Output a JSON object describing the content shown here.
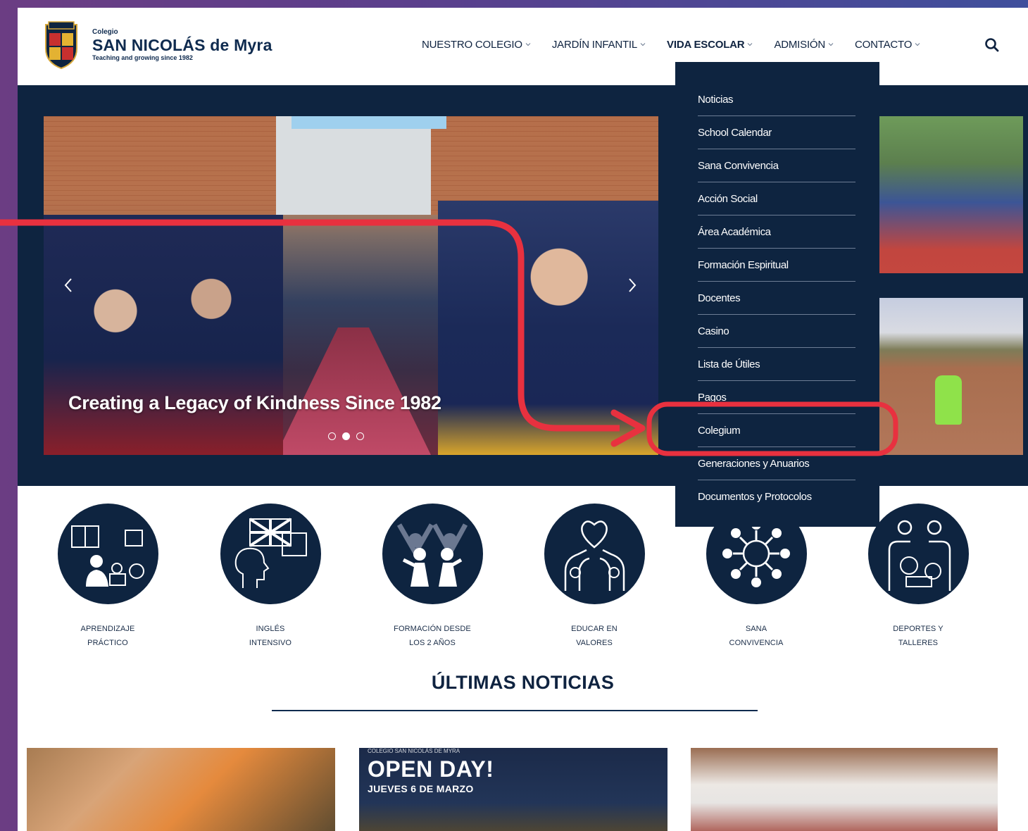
{
  "logo": {
    "small": "Colegio",
    "name": "SAN NICOLÁS de Myra",
    "tagline": "Teaching and growing since 1982"
  },
  "nav": [
    {
      "label": "NUESTRO COLEGIO"
    },
    {
      "label": "JARDÍN INFANTIL"
    },
    {
      "label": "VIDA ESCOLAR",
      "active": true
    },
    {
      "label": "ADMISIÓN"
    },
    {
      "label": "CONTACTO"
    }
  ],
  "search_icon": "search-icon",
  "dropdown": [
    {
      "label": "Noticias"
    },
    {
      "label": "School Calendar"
    },
    {
      "label": "Sana Convivencia"
    },
    {
      "label": "Acción Social"
    },
    {
      "label": "Área Académica"
    },
    {
      "label": "Formación Espiritual"
    },
    {
      "label": "Docentes"
    },
    {
      "label": "Casino"
    },
    {
      "label": "Lista de Útiles"
    },
    {
      "label": "Pagos"
    },
    {
      "label": "Colegium",
      "highlighted": true
    },
    {
      "label": "Generaciones y Anuarios"
    },
    {
      "label": "Documentos y Protocolos"
    }
  ],
  "hero": {
    "caption": "Creating a Legacy of Kindness Since 1982",
    "active_dot": 2,
    "dot_count": 3
  },
  "features": [
    {
      "line1": "APRENDIZAJE",
      "line2": "PRÁCTICO",
      "icon": "learning-icon"
    },
    {
      "line1": "INGLÉS",
      "line2": "INTENSIVO",
      "icon": "english-icon"
    },
    {
      "line1": "FORMACIÓN DESDE",
      "line2": "LOS 2 AÑOS",
      "icon": "children-icon"
    },
    {
      "line1": "EDUCAR EN",
      "line2": "VALORES",
      "icon": "heart-hands-icon"
    },
    {
      "line1": "SANA",
      "line2": "CONVIVENCIA",
      "icon": "community-icon"
    },
    {
      "line1": "DEPORTES Y",
      "line2": "TALLERES",
      "icon": "sports-icon"
    }
  ],
  "news": {
    "title": "ÚLTIMAS NOTICIAS",
    "openday": {
      "school": "COLEGIO SAN NICOLÁS DE MYRA",
      "title": "OPEN DAY!",
      "date": "JUEVES 6 DE MARZO"
    }
  },
  "colors": {
    "navy": "#0e2440",
    "annotation_red": "#e8313f",
    "dropdown_divider": "#6d7d95"
  }
}
